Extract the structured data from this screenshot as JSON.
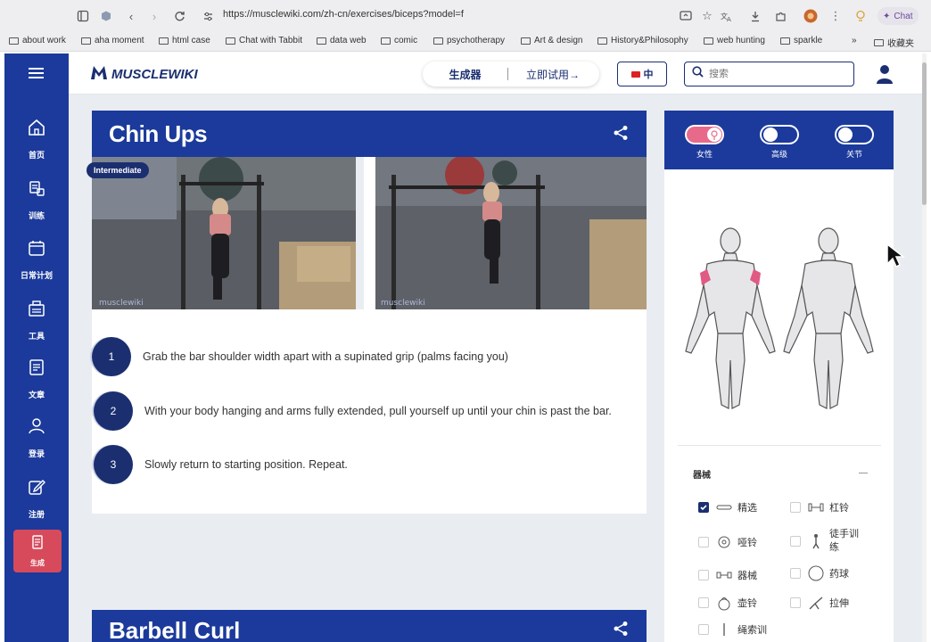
{
  "browser": {
    "url": "https://musclewiki.com/zh-cn/exercises/biceps?model=f",
    "chat_label": "Chat",
    "bookmarks": [
      "about work",
      "aha moment",
      "html case",
      "Chat with Tabbit",
      "data web",
      "comic",
      "psychotherapy",
      "Art & design",
      "History&Philosophy",
      "web hunting",
      "sparkle"
    ],
    "more_label": "»",
    "favorites_label": "收藏夹"
  },
  "sidebar": {
    "items": [
      {
        "label": "首页",
        "icon": "home-icon"
      },
      {
        "label": "训练",
        "icon": "dumbbell-icon"
      },
      {
        "label": "日常计划",
        "icon": "calendar-icon"
      },
      {
        "label": "工具",
        "icon": "tools-icon"
      },
      {
        "label": "文章",
        "icon": "article-icon"
      },
      {
        "label": "登录",
        "icon": "login-icon"
      },
      {
        "label": "注册",
        "icon": "register-icon"
      },
      {
        "label": "生成",
        "icon": "generate-icon"
      }
    ]
  },
  "header": {
    "logo_text": "MUSCLEWIKI",
    "generator_label": "生成器",
    "try_now_label": "立即试用→",
    "language_label": "中",
    "search_placeholder": "搜索"
  },
  "exercise": {
    "title": "Chin Ups",
    "difficulty": "Intermediate",
    "steps": [
      {
        "num": "1",
        "text": "Grab the bar shoulder width apart with a supinated grip (palms facing you)"
      },
      {
        "num": "2",
        "text": "With your body hanging and arms fully extended, pull yourself up until your chin is past the bar."
      },
      {
        "num": "3",
        "text": "Slowly return to starting position. Repeat."
      }
    ]
  },
  "next_exercise": {
    "title": "Barbell Curl"
  },
  "filters": {
    "toggles": [
      {
        "label": "女性",
        "on": true
      },
      {
        "label": "高级",
        "on": false
      },
      {
        "label": "关节",
        "on": false
      }
    ],
    "equipment_title": "器械",
    "equipment": [
      {
        "label": "精选",
        "checked": true,
        "icon": "featured-icon"
      },
      {
        "label": "杠铃",
        "checked": false,
        "icon": "barbell-icon"
      },
      {
        "label": "哑铃",
        "checked": false,
        "icon": "dumbbell-icon"
      },
      {
        "label": "徒手训练",
        "checked": false,
        "icon": "bodyweight-icon"
      },
      {
        "label": "器械",
        "checked": false,
        "icon": "machine-icon"
      },
      {
        "label": "药球",
        "checked": false,
        "icon": "medicine-ball-icon"
      },
      {
        "label": "壶铃",
        "checked": false,
        "icon": "kettlebell-icon"
      },
      {
        "label": "拉伸",
        "checked": false,
        "icon": "stretch-icon"
      },
      {
        "label": "绳索训",
        "checked": false,
        "icon": "cable-icon"
      }
    ]
  },
  "colors": {
    "primary": "#1b3a9b",
    "dark_navy": "#1b2f70",
    "accent_pink": "#e86a8b",
    "active_red": "#d74a5c",
    "page_bg": "#e9ecf1"
  }
}
